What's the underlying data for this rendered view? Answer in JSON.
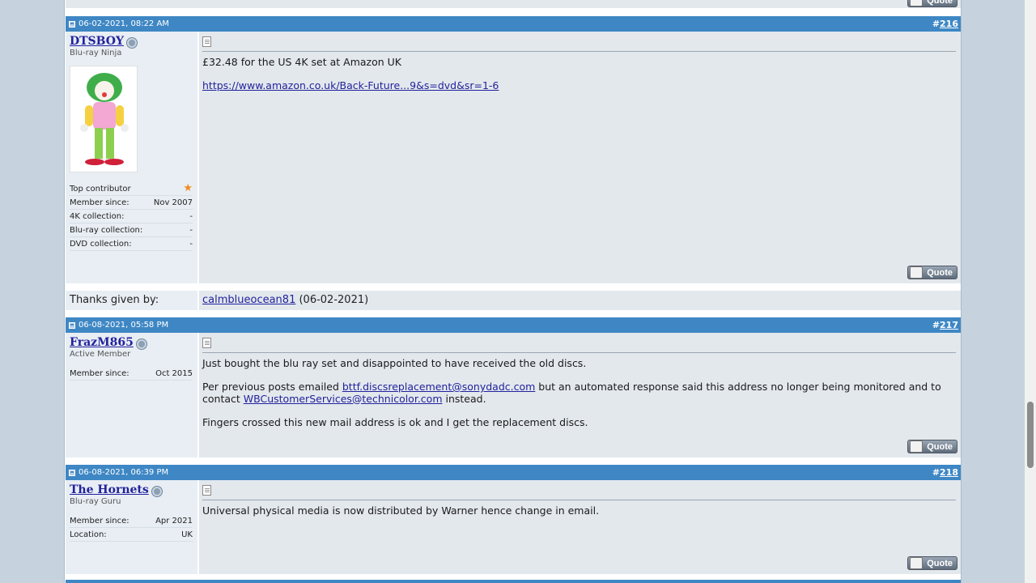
{
  "posts": [
    {
      "date": "06-02-2021, 08:22 AM",
      "number": "216",
      "number_prefix": "#",
      "username": "DTSBOY",
      "user_title": "Blu-ray Ninja",
      "stats": [
        {
          "label": "Top contributor",
          "value": ""
        },
        {
          "label": "Member since:",
          "value": "Nov 2007"
        },
        {
          "label": "4K collection:",
          "value": "-"
        },
        {
          "label": "Blu-ray collection:",
          "value": "-"
        },
        {
          "label": "DVD collection:",
          "value": "-"
        }
      ],
      "message_line1": "£32.48 for the US 4K set at Amazon UK",
      "message_link": "https://www.amazon.co.uk/Back-Future...9&s=dvd&sr=1-6"
    },
    {
      "date": "06-08-2021, 05:58 PM",
      "number": "217",
      "number_prefix": "#",
      "username": "FrazM865",
      "user_title": "Active Member",
      "stats": [
        {
          "label": "Member since:",
          "value": "Oct 2015"
        }
      ],
      "p1": "Just bought the blu ray set and disappointed to have received the old discs.",
      "p2_a": "Per previous posts emailed ",
      "p2_link1": "bttf.discsreplacement@sonydadc.com",
      "p2_b": " but an automated response said this address no longer being monitored and to contact ",
      "p2_link2": "WBCustomerServices@technicolor.com",
      "p2_c": " instead.",
      "p3": "Fingers crossed this new mail address is ok and I get the replacement discs."
    },
    {
      "date": "06-08-2021, 06:39 PM",
      "number": "218",
      "number_prefix": "#",
      "username": "The Hornets",
      "user_title": "Blu-ray Guru",
      "stats": [
        {
          "label": "Member since:",
          "value": "Apr 2021"
        },
        {
          "label": "Location:",
          "value": "UK"
        }
      ],
      "message": "Universal physical media is now distributed by Warner hence change in email."
    }
  ],
  "thanks": {
    "label": "Thanks given by:",
    "user": "calmblueocean81",
    "date": "(06-02-2021)"
  },
  "quote_label": "Quote",
  "colors": {
    "header": "#3e87c4",
    "user_bg": "#e8eef4",
    "post_bg": "#e3e8ed",
    "link": "#22229c"
  },
  "icons": [
    "post-old-icon",
    "offline-status-icon",
    "post-icon",
    "quote-icon",
    "top-contributor-star-icon"
  ]
}
